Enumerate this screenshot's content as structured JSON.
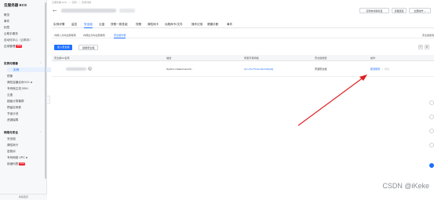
{
  "sidebar": {
    "title": "云服务器 ECS",
    "items": [
      {
        "label": "概览"
      },
      {
        "label": "事件"
      },
      {
        "label": "标签"
      },
      {
        "label": "云助手服务"
      },
      {
        "label": "自动化中心（云助手）"
      },
      {
        "label": "应用管理",
        "badge": "NEW"
      }
    ],
    "section1": "实例与镜像",
    "section1_items": [
      {
        "label": "实例",
        "active": true
      },
      {
        "label": "镜像"
      },
      {
        "label": "弹性容器实例 ECI"
      },
      {
        "label": "专有宿主机 DDH"
      },
      {
        "label": "云盒"
      },
      {
        "label": "超级计算集群"
      },
      {
        "label": "预留实例券"
      },
      {
        "label": "节省计划"
      },
      {
        "label": "资源保障"
      }
    ],
    "section2": "网络与安全",
    "section2_items": [
      {
        "label": "安全组"
      },
      {
        "label": "弹性网卡"
      },
      {
        "label": "密钥对"
      },
      {
        "label": "专有网络 VPC"
      },
      {
        "label": "前缀列表",
        "badge": "NEW"
      }
    ],
    "footer": "新版首页"
  },
  "breadcrumb": [
    "云服务器 ECS",
    "实例",
    "实例详情"
  ],
  "header": {
    "buttons": [
      {
        "label": "实例未关联标签"
      },
      {
        "label": "远程连接"
      },
      {
        "label": "全部操作"
      }
    ]
  },
  "tabs": [
    {
      "label": "实例详情"
    },
    {
      "label": "监控"
    },
    {
      "label": "安全组",
      "active": true
    },
    {
      "label": "云盘"
    },
    {
      "label": "快照一致性组"
    },
    {
      "label": "快照"
    },
    {
      "label": "弹性网卡"
    },
    {
      "label": "远程命令/文件"
    },
    {
      "label": "操作记录"
    },
    {
      "label": "健康诊断"
    },
    {
      "label": "事件"
    }
  ],
  "subtabs": [
    {
      "label": "内网入方向全部规则"
    },
    {
      "label": "内网出方向全部规则"
    },
    {
      "label": "安全组列表",
      "active": true
    }
  ],
  "help_link": "安全组使用",
  "toolbar": {
    "join_label": "加入安全组",
    "replace_label": "替换安全组"
  },
  "table": {
    "columns": [
      "安全组ID/名称",
      "描述",
      "所属专有网络",
      "安全组类型",
      "操作"
    ],
    "rows": [
      {
        "description": "System created securit...",
        "vpc": "vpc-2ze77tcponktobd2gpfg",
        "type": "普通安全组",
        "op_primary": "配置规则",
        "op_secondary": "移出"
      }
    ]
  },
  "watermark": "CSDN @iKeke"
}
